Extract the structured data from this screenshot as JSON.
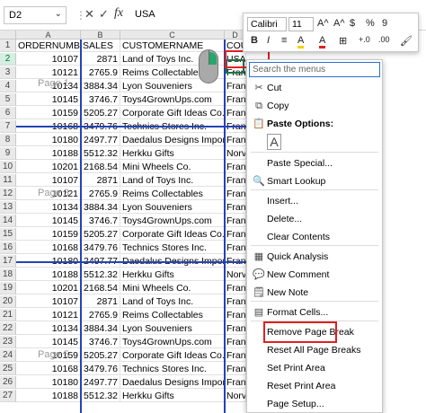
{
  "formula_bar": {
    "name_box": "D2",
    "fx": "fx",
    "value": "USA"
  },
  "columns": [
    {
      "letter": "A"
    },
    {
      "letter": "B"
    },
    {
      "letter": "C"
    },
    {
      "letter": "D"
    }
  ],
  "rows": [
    {
      "n": "1",
      "a": "ORDERNUMBER",
      "b": "SALES",
      "c": "CUSTOMERNAME",
      "d": "COU"
    },
    {
      "n": "2",
      "a": "10107",
      "b": "2871",
      "c": "Land of Toys Inc.",
      "d": "USA"
    },
    {
      "n": "3",
      "a": "10121",
      "b": "2765.9",
      "c": "Reims Collectables",
      "d": "Fran"
    },
    {
      "n": "4",
      "a": "10134",
      "b": "3884.34",
      "c": "Lyon Souveniers",
      "d": "Fran"
    },
    {
      "n": "5",
      "a": "10145",
      "b": "3746.7",
      "c": "Toys4GrownUps.com",
      "d": "Fran"
    },
    {
      "n": "6",
      "a": "10159",
      "b": "5205.27",
      "c": "Corporate Gift Ideas Co.",
      "d": "Fran"
    },
    {
      "n": "7",
      "a": "10168",
      "b": "3479.76",
      "c": "Technics Stores Inc.",
      "d": "Fran"
    },
    {
      "n": "8",
      "a": "10180",
      "b": "2497.77",
      "c": "Daedalus Designs Imports",
      "d": "Fran"
    },
    {
      "n": "9",
      "a": "10188",
      "b": "5512.32",
      "c": "Herkku Gifts",
      "d": "Norv"
    },
    {
      "n": "10",
      "a": "10201",
      "b": "2168.54",
      "c": "Mini Wheels Co.",
      "d": "Fran"
    },
    {
      "n": "11",
      "a": "10107",
      "b": "2871",
      "c": "Land of Toys Inc.",
      "d": "Fran"
    },
    {
      "n": "12",
      "a": "10121",
      "b": "2765.9",
      "c": "Reims Collectables",
      "d": "Fran"
    },
    {
      "n": "13",
      "a": "10134",
      "b": "3884.34",
      "c": "Lyon Souveniers",
      "d": "Fran"
    },
    {
      "n": "14",
      "a": "10145",
      "b": "3746.7",
      "c": "Toys4GrownUps.com",
      "d": "Fran"
    },
    {
      "n": "15",
      "a": "10159",
      "b": "5205.27",
      "c": "Corporate Gift Ideas Co.",
      "d": "Fran"
    },
    {
      "n": "16",
      "a": "10168",
      "b": "3479.76",
      "c": "Technics Stores Inc.",
      "d": "Fran"
    },
    {
      "n": "17",
      "a": "10180",
      "b": "2497.77",
      "c": "Daedalus Designs Imports",
      "d": "Fran"
    },
    {
      "n": "18",
      "a": "10188",
      "b": "5512.32",
      "c": "Herkku Gifts",
      "d": "Norv"
    },
    {
      "n": "19",
      "a": "10201",
      "b": "2168.54",
      "c": "Mini Wheels Co.",
      "d": "Fran"
    },
    {
      "n": "20",
      "a": "10107",
      "b": "2871",
      "c": "Land of Toys Inc.",
      "d": "Fran"
    },
    {
      "n": "21",
      "a": "10121",
      "b": "2765.9",
      "c": "Reims Collectables",
      "d": "Fran"
    },
    {
      "n": "22",
      "a": "10134",
      "b": "3884.34",
      "c": "Lyon Souveniers",
      "d": "Fran"
    },
    {
      "n": "23",
      "a": "10145",
      "b": "3746.7",
      "c": "Toys4GrownUps.com",
      "d": "Fran"
    },
    {
      "n": "24",
      "a": "10159",
      "b": "5205.27",
      "c": "Corporate Gift Ideas Co.",
      "d": "Fran"
    },
    {
      "n": "25",
      "a": "10168",
      "b": "3479.76",
      "c": "Technics Stores Inc.",
      "d": "Fran"
    },
    {
      "n": "26",
      "a": "10180",
      "b": "2497.77",
      "c": "Daedalus Designs Imports",
      "d": "Fran"
    },
    {
      "n": "27",
      "a": "10188",
      "b": "5512.32",
      "c": "Herkku Gifts",
      "d": "Norv"
    }
  ],
  "watermarks": [
    "Page 1",
    "Page 3",
    "Page 5"
  ],
  "mini_toolbar": {
    "font": "Calibri",
    "size": "11",
    "buttons": [
      "A^",
      "A^",
      "$",
      "%",
      "9",
      "B",
      "I",
      "≡",
      "A",
      "A",
      "⊞",
      "+.0",
      ".00",
      "🖌"
    ]
  },
  "context_menu": {
    "search_placeholder": "Search the menus",
    "items": [
      {
        "label": "Cut",
        "icon": "✂"
      },
      {
        "label": "Copy",
        "icon": "⧉"
      },
      {
        "label": "Paste Options:",
        "icon": "📋"
      },
      {
        "label": "",
        "icon": "A"
      },
      {
        "label": "Paste Special...",
        "icon": ""
      },
      {
        "label": "Smart Lookup",
        "icon": "🔍"
      },
      {
        "label": "Insert...",
        "icon": ""
      },
      {
        "label": "Delete...",
        "icon": ""
      },
      {
        "label": "Clear Contents",
        "icon": ""
      },
      {
        "label": "Quick Analysis",
        "icon": "▦"
      },
      {
        "label": "New Comment",
        "icon": "💬"
      },
      {
        "label": "New Note",
        "icon": "🗒"
      },
      {
        "label": "Format Cells...",
        "icon": "▤"
      },
      {
        "label": "Remove Page Break",
        "icon": ""
      },
      {
        "label": "Reset All Page Breaks",
        "icon": ""
      },
      {
        "label": "Set Print Area",
        "icon": ""
      },
      {
        "label": "Reset Print Area",
        "icon": ""
      },
      {
        "label": "Page Setup...",
        "icon": ""
      }
    ]
  },
  "colors": {
    "accent": "#217346",
    "page_break": "#2443b5",
    "highlight": "#e02020"
  }
}
